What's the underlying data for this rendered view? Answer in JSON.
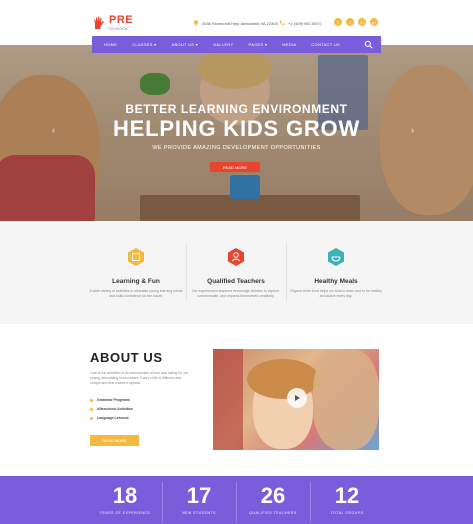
{
  "header": {
    "logo": {
      "name": "PRE",
      "sub": "SCHOOL"
    },
    "address": "4036 Richmond Hwy, Alexandria VA 22303",
    "phone": "+1 (409) 987-5874",
    "socials": [
      "t",
      "f",
      "in",
      "g+"
    ]
  },
  "nav": {
    "items": [
      "HOME",
      "CLASSES ▾",
      "ABOUT US ▾",
      "GALLERY",
      "PAGES ▾",
      "MEDIA",
      "CONTACT US"
    ]
  },
  "hero": {
    "eyebrow": "BETTER LEARNING ENVIRONMENT",
    "title": "HELPING KIDS GROW",
    "subtitle": "WE PROVIDE AMAZING DEVELOPMENT OPPORTUNITIES",
    "button": "READ MORE"
  },
  "features": [
    {
      "title": "Learning & Fun",
      "text": "A wide variety of activities to stimulate young learning minds and build confidence for the future.",
      "color": "#f4b942"
    },
    {
      "title": "Qualified Teachers",
      "text": "Our experienced teachers encourage children to explore, communicate, and express themselves creatively.",
      "color": "#e8452e"
    },
    {
      "title": "Healthy Meals",
      "text": "Organic fresh food helps our kids to learn and to be healthy and active every day.",
      "color": "#3bb2b8"
    }
  ],
  "about": {
    "title": "ABOUT US",
    "text": "Lots of fun activities in an atmosphere of love and caring for our young, stimulating environment. Every child is different and unique and that makes it special.",
    "list": [
      "Grammar Programs",
      "Afterschool Activities",
      "Language Lessons"
    ],
    "button": "READ MORE"
  },
  "stats": [
    {
      "value": "18",
      "label": "YEARS OF EXPERIENCE"
    },
    {
      "value": "17",
      "label": "NEW STUDENTS"
    },
    {
      "value": "26",
      "label": "QUALIFIED TEACHERS"
    },
    {
      "value": "12",
      "label": "TOTAL GROUPS"
    }
  ]
}
